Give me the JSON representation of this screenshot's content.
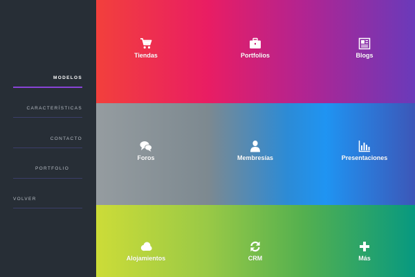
{
  "sidebar": {
    "items": [
      {
        "label": "Modelos",
        "active": true
      },
      {
        "label": "Características",
        "active": false
      },
      {
        "label": "Contacto",
        "active": false
      },
      {
        "label": "Portfolio",
        "active": false
      },
      {
        "label": "Volver",
        "active": false
      }
    ]
  },
  "tiles": [
    {
      "label": "Tiendas",
      "icon": "shopping-cart-icon"
    },
    {
      "label": "Portfolios",
      "icon": "briefcase-icon"
    },
    {
      "label": "Blogs",
      "icon": "newspaper-icon"
    },
    {
      "label": "Foros",
      "icon": "chat-bubbles-icon"
    },
    {
      "label": "Membresías",
      "icon": "user-icon"
    },
    {
      "label": "Presentaciones",
      "icon": "bar-chart-icon"
    },
    {
      "label": "Alojamientos",
      "icon": "cloud-icon"
    },
    {
      "label": "CRM",
      "icon": "refresh-icon"
    },
    {
      "label": "Más",
      "icon": "plus-icon"
    }
  ],
  "colors": {
    "sidebar_bg": "#272e36",
    "active_underline": "#8a44d8"
  }
}
